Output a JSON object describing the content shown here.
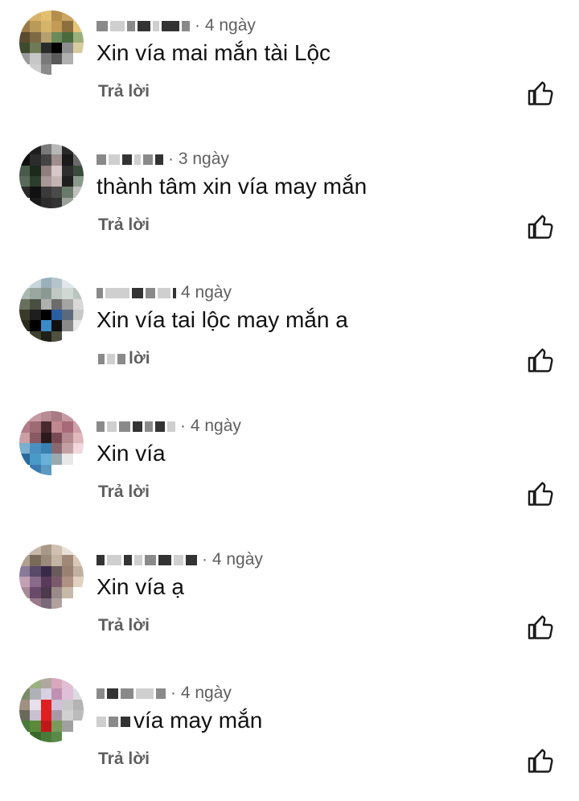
{
  "comments": [
    {
      "time": "· 4 ngày",
      "text": "Xin vía mai mắn tài Lộc",
      "reply": "Trả lời",
      "avatar": [
        "#c8a15a",
        "#d8b26a",
        "#e2bf6f",
        "#b58d4d",
        "#caa463",
        "#e8d08a",
        "#9a7b45",
        "#b99a58",
        "#d6b46b",
        "#c39b57",
        "#8d6f3f",
        "#e6c57a",
        "#5a4a30",
        "#7d6a45",
        "#b5a06e",
        "#6b8a5c",
        "#4a6a3e",
        "#9ab07a",
        "#3d4a2c",
        "#6f7b55",
        "#2b2b2b",
        "#000000",
        "#8d8d8d",
        "#d9cba0",
        "#9a9a9a",
        "#c7c7c7",
        "#7a7a7a",
        "#5a5a5a",
        "#b0b0b0",
        "#ffffff",
        "#ffffff",
        "#cfcfcf",
        "#8a8a8a",
        "#ffffff",
        "#ffffff",
        "#ffffff"
      ]
    },
    {
      "time": "· 3 ngày",
      "text": "thành tâm xin vía may mắn",
      "reply": "Trả lời",
      "avatar": [
        "#3a3a3a",
        "#1e1e1e",
        "#7a7a7a",
        "#b8b8b8",
        "#2a2a2a",
        "#9a9a9a",
        "#0f0f0f",
        "#2c2c2c",
        "#444444",
        "#9e8e8e",
        "#1a1a1a",
        "#6a6a6a",
        "#4a5a4a",
        "#1c2a1c",
        "#8e7e7e",
        "#d6c8c8",
        "#2e2e2e",
        "#3b4b3b",
        "#5a6a5a",
        "#2e3e2e",
        "#a89898",
        "#c4b4b4",
        "#1f1f1f",
        "#8a9a8a",
        "#2a2a2a",
        "#111111",
        "#3a3a3a",
        "#4a4a4a",
        "#6a7a6a",
        "#c0c0c0",
        "#ffffff",
        "#1b1b1b",
        "#2c2c2c",
        "#333333",
        "#9aa09a",
        "#ffffff"
      ]
    },
    {
      "time": "4 ngày",
      "text": "Xin vía tai lộc may mắn a",
      "reply": "lời",
      "avatar": [
        "#e6eef2",
        "#c6d6dc",
        "#9ab0bb",
        "#b4c4ca",
        "#dfe7ea",
        "#f2f2f2",
        "#a8b8b0",
        "#9aa6a0",
        "#8a9a92",
        "#c0c8c4",
        "#d0d8d4",
        "#bcc4c0",
        "#6a7060",
        "#4a5040",
        "#b0b0b0",
        "#6c6c6c",
        "#a4a4a4",
        "#d8d8d8",
        "#3a3a2a",
        "#1e1e1e",
        "#000000",
        "#2a5ea0",
        "#5a6a7a",
        "#c8c8c8",
        "#2a2a20",
        "#000000",
        "#3a8ac8",
        "#101010",
        "#8a8a8a",
        "#e8e8e8",
        "#ffffff",
        "#404030",
        "#20201a",
        "#505040",
        "#ffffff",
        "#ffffff"
      ]
    },
    {
      "time": "· 4 ngày",
      "text": "Xin vía",
      "reply": "Trả lời",
      "avatar": [
        "#d8a8b0",
        "#c89aa4",
        "#b88a94",
        "#a87a84",
        "#c49aa0",
        "#e4c4c8",
        "#b47c88",
        "#9e6a74",
        "#4a2a30",
        "#c08890",
        "#a86a78",
        "#d0a0a8",
        "#caa0a4",
        "#8a5a64",
        "#2a1a1e",
        "#7a4a54",
        "#b48a90",
        "#e0b8bc",
        "#7ab0d0",
        "#4a90c0",
        "#3a80b0",
        "#8a6a70",
        "#c4a0a4",
        "#f0d8dc",
        "#2a6a9a",
        "#4a9ac8",
        "#6ab0d8",
        "#9aa8b0",
        "#e8e8e8",
        "#ffffff",
        "#ffffff",
        "#3a7ab0",
        "#5a9ac0",
        "#ffffff",
        "#ffffff",
        "#ffffff"
      ]
    },
    {
      "time": "· 4 ngày",
      "text": "Xin vía ạ",
      "reply": "Trả lời",
      "avatar": [
        "#e0d8d0",
        "#c8b8a8",
        "#a89888",
        "#d0c0b0",
        "#e8e0d8",
        "#f4f0ec",
        "#b0a090",
        "#7a6a5a",
        "#9a8a7a",
        "#c4b4a4",
        "#a08878",
        "#d8c8b8",
        "#8a7a9a",
        "#5a4a6a",
        "#3a2a4a",
        "#6a5a5a",
        "#9a8070",
        "#c0b0a0",
        "#c4a0b4",
        "#8a6a8a",
        "#5a3a5a",
        "#7a5a6a",
        "#b09080",
        "#e0d0c0",
        "#a88898",
        "#6a4a6a",
        "#4a3a4a",
        "#9a8a8a",
        "#c8b8a8",
        "#ffffff",
        "#ffffff",
        "#9a7a8a",
        "#7a6a7a",
        "#b0a0a0",
        "#ffffff",
        "#ffffff"
      ]
    },
    {
      "time": "· 4 ngày",
      "text": "vía may mắn",
      "reply": "Trả lời",
      "avatar": [
        "#c0b8a0",
        "#9ab080",
        "#b0a8a0",
        "#d8a8c0",
        "#e0c0d0",
        "#f4f4f4",
        "#7a8a6a",
        "#b0b0b8",
        "#d8d0e0",
        "#c090b0",
        "#e0c0d8",
        "#dcdcdc",
        "#a09080",
        "#e8e0ec",
        "#e02020",
        "#d0c0d8",
        "#c8c8c8",
        "#b4b4b4",
        "#6a6a5a",
        "#c8c0d0",
        "#e02020",
        "#a898a8",
        "#d0d0d0",
        "#bcbcbc",
        "#4a7a3a",
        "#5a8a3a",
        "#c01818",
        "#7a9a5a",
        "#a0a0a0",
        "#ffffff",
        "#ffffff",
        "#3a6a2a",
        "#4a7a3a",
        "#5a8a4a",
        "#ffffff",
        "#ffffff"
      ]
    }
  ]
}
